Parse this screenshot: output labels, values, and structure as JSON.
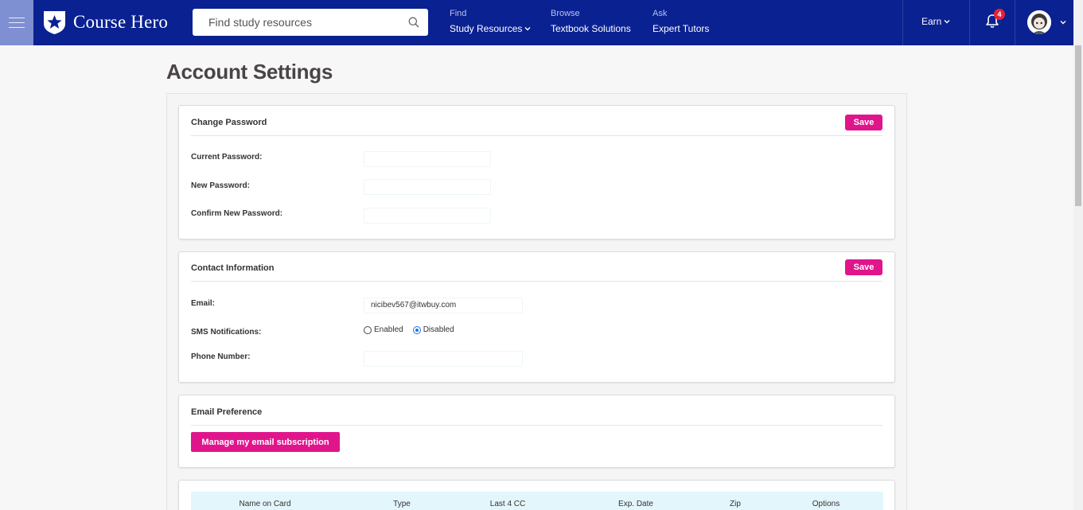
{
  "header": {
    "logo_text": "Course Hero",
    "search_placeholder": "Find study resources",
    "nav": [
      {
        "small": "Find",
        "main": "Study Resources",
        "has_dropdown": true
      },
      {
        "small": "Browse",
        "main": "Textbook Solutions",
        "has_dropdown": false
      },
      {
        "small": "Ask",
        "main": "Expert Tutors",
        "has_dropdown": false
      }
    ],
    "earn_label": "Earn",
    "notification_count": "4",
    "colors": {
      "bar": "#0a2191",
      "menu": "#7e90d2",
      "accent": "#e0158c",
      "badge": "#e4213b"
    }
  },
  "page": {
    "title": "Account Settings"
  },
  "change_password": {
    "title": "Change Password",
    "save_label": "Save",
    "current_label": "Current Password:",
    "new_label": "New Password:",
    "confirm_label": "Confirm New Password:"
  },
  "contact": {
    "title": "Contact Information",
    "save_label": "Save",
    "email_label": "Email:",
    "email_value": "nicibev567@itwbuy.com",
    "sms_label": "SMS Notifications:",
    "sms_options": [
      "Enabled",
      "Disabled"
    ],
    "sms_selected": "Disabled",
    "phone_label": "Phone Number:"
  },
  "email_pref": {
    "title": "Email Preference",
    "manage_label": "Manage my email subscription"
  },
  "cards_table": {
    "columns": [
      "Name on Card",
      "Type",
      "Last 4 CC",
      "Exp. Date",
      "Zip",
      "Options"
    ]
  }
}
